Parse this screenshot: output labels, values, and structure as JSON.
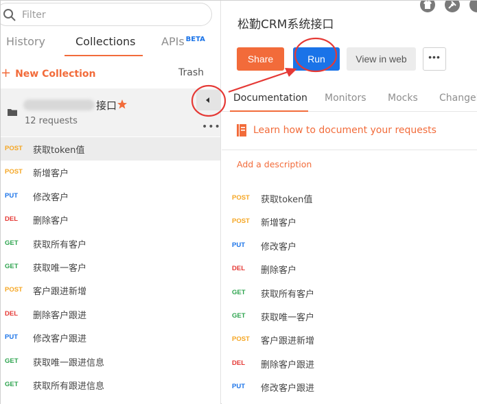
{
  "search": {
    "placeholder": "Filter",
    "icon": "search-icon"
  },
  "sidebar": {
    "tabs": [
      {
        "label": "History"
      },
      {
        "label": "Collections"
      },
      {
        "label": "APIs",
        "badge": "BETA"
      }
    ],
    "new_collection_label": "New Collection",
    "trash_label": "Trash",
    "collection": {
      "name_visible": "接口",
      "count": "12 requests",
      "icons": [
        "folder-icon",
        "star-icon"
      ]
    },
    "requests": [
      {
        "method": "POST",
        "name": "获取token值"
      },
      {
        "method": "POST",
        "name": "新增客户"
      },
      {
        "method": "PUT",
        "name": "修改客户"
      },
      {
        "method": "DEL",
        "name": "删除客户"
      },
      {
        "method": "GET",
        "name": "获取所有客户"
      },
      {
        "method": "GET",
        "name": "获取唯一客户"
      },
      {
        "method": "POST",
        "name": "客户跟进新增"
      },
      {
        "method": "DEL",
        "name": "删除客户跟进"
      },
      {
        "method": "PUT",
        "name": "修改客户跟进"
      },
      {
        "method": "GET",
        "name": "获取唯一跟进信息"
      },
      {
        "method": "GET",
        "name": "获取所有跟进信息"
      }
    ]
  },
  "main": {
    "title": "松勤CRM系统接口",
    "buttons": {
      "share": "Share",
      "run": "Run",
      "view_web": "View in web",
      "more": "•••"
    },
    "tabs": [
      {
        "label": "Documentation"
      },
      {
        "label": "Monitors"
      },
      {
        "label": "Mocks"
      },
      {
        "label": "Changelog"
      }
    ],
    "learn_link": "Learn how to document your requests",
    "add_description": "Add a description",
    "requests": [
      {
        "method": "POST",
        "name": "获取token值"
      },
      {
        "method": "POST",
        "name": "新增客户"
      },
      {
        "method": "PUT",
        "name": "修改客户"
      },
      {
        "method": "DEL",
        "name": "删除客户"
      },
      {
        "method": "GET",
        "name": "获取所有客户"
      },
      {
        "method": "GET",
        "name": "获取唯一客户"
      },
      {
        "method": "POST",
        "name": "客户跟进新增"
      },
      {
        "method": "DEL",
        "name": "删除客户跟进"
      },
      {
        "method": "PUT",
        "name": "修改客户跟进"
      }
    ]
  },
  "colors": {
    "accent": "#f26b3a",
    "run_blue": "#1a73e8",
    "post": "#f5a623",
    "put": "#1a73e8",
    "del": "#e53935",
    "get": "#2ea44f",
    "annotation_red": "#e53935"
  }
}
